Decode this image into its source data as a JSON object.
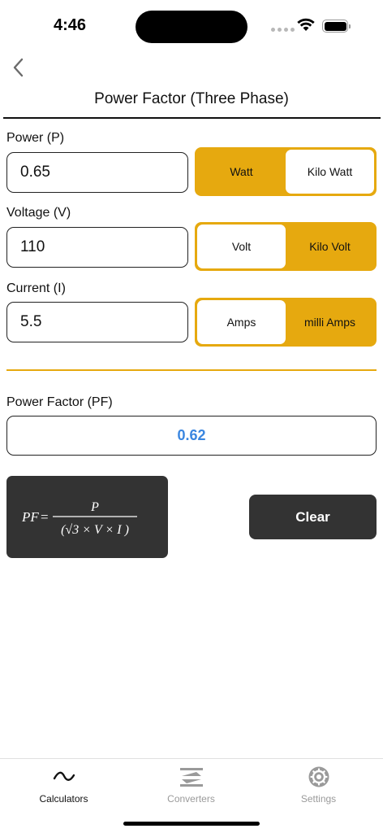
{
  "status_bar": {
    "time": "4:46"
  },
  "header": {
    "title": "Power Factor (Three Phase)"
  },
  "fields": [
    {
      "label": "Power (P)",
      "value": "0.65",
      "units": [
        {
          "label": "Watt",
          "selected": false
        },
        {
          "label": "Kilo Watt",
          "selected": true
        }
      ]
    },
    {
      "label": "Voltage (V)",
      "value": "110",
      "units": [
        {
          "label": "Volt",
          "selected": true
        },
        {
          "label": "Kilo Volt",
          "selected": false
        }
      ]
    },
    {
      "label": "Current (I)",
      "value": "5.5",
      "units": [
        {
          "label": "Amps",
          "selected": true
        },
        {
          "label": "milli Amps",
          "selected": false
        }
      ]
    }
  ],
  "result": {
    "label": "Power Factor (PF)",
    "value": "0.62"
  },
  "formula": {
    "lhs": "PF",
    "numerator": "P",
    "denominator": "(√3 × V × I )"
  },
  "actions": {
    "clear_label": "Clear"
  },
  "tabs": [
    {
      "label": "Calculators",
      "icon": "tilde-icon",
      "active": true
    },
    {
      "label": "Converters",
      "icon": "swap-arrows-icon",
      "active": false
    },
    {
      "label": "Settings",
      "icon": "gear-icon",
      "active": false
    }
  ],
  "colors": {
    "accent": "#e6a90f",
    "result_text": "#3a86e0",
    "dark_card": "#333333"
  }
}
